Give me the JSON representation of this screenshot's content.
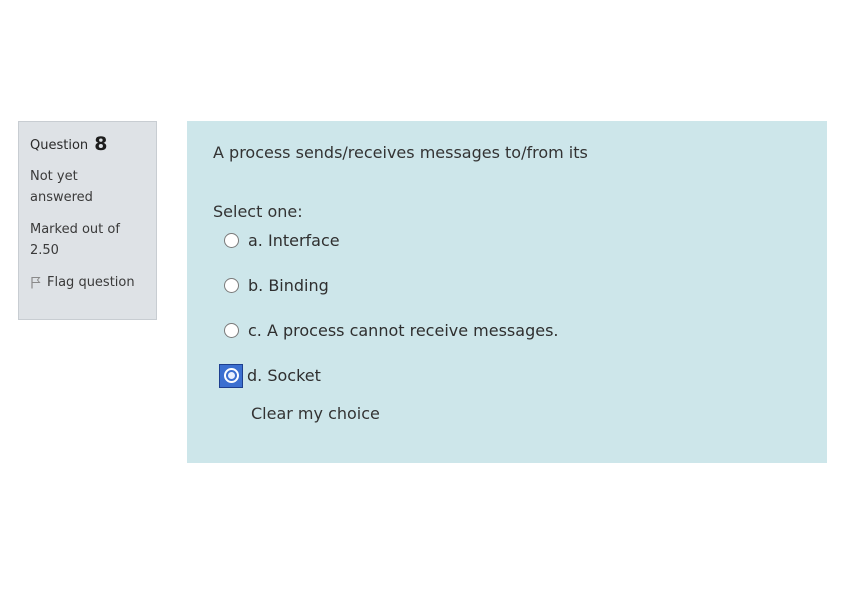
{
  "question_info": {
    "label": "Question",
    "number": "8",
    "state_line1": "Not yet",
    "state_line2": "answered",
    "grade_line1": "Marked out of",
    "grade_line2": "2.50",
    "flag_label": "Flag question"
  },
  "question": {
    "text": "A process sends/receives messages to/from its",
    "prompt": "Select one:",
    "answers": [
      {
        "label": "a. Interface",
        "selected": false
      },
      {
        "label": "b. Binding",
        "selected": false
      },
      {
        "label": "c. A process cannot receive messages.",
        "selected": false
      },
      {
        "label": "d. Socket",
        "selected": true
      }
    ],
    "clear_label": "Clear my choice"
  },
  "colors": {
    "info_bg": "#dee2e6",
    "content_bg": "#cde6ea",
    "selected_radio": "#3b6fd0"
  }
}
